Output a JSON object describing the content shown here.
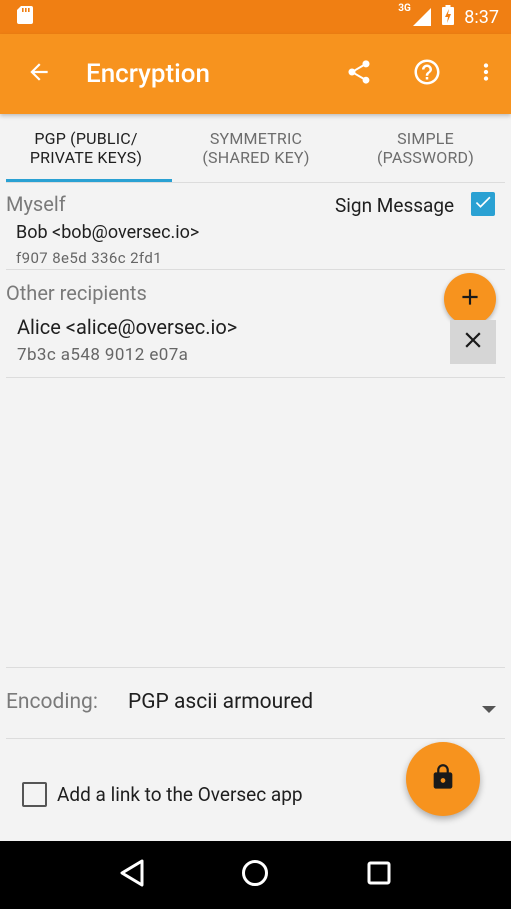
{
  "status_bar": {
    "time": "8:37",
    "network": "3G",
    "icons": [
      "sd-card-icon",
      "signal-icon",
      "battery-charging-icon"
    ]
  },
  "app_bar": {
    "title": "Encryption",
    "icons": [
      "back-arrow-icon",
      "share-icon",
      "help-icon",
      "more-vert-icon"
    ]
  },
  "tabs": [
    {
      "label": "PGP (PUBLIC/\nPRIVATE KEYS)",
      "active": true
    },
    {
      "label": "SYMMETRIC\n(SHARED KEY)",
      "active": false
    },
    {
      "label": "SIMPLE\n(PASSWORD)",
      "active": false
    }
  ],
  "myself": {
    "section_label": "Myself",
    "sign_message_label": "Sign Message",
    "sign_message_checked": true,
    "key": {
      "name": "Bob <bob@oversec.io>",
      "fingerprint": "f907 8e5d 336c 2fd1"
    }
  },
  "recipients": {
    "section_label": "Other recipients",
    "items": [
      {
        "name": "Alice <alice@oversec.io>",
        "fingerprint": "7b3c a548 9012 e07a"
      }
    ]
  },
  "encoding": {
    "label": "Encoding:",
    "value": "PGP ascii armoured"
  },
  "footer": {
    "link_label": "Add a link to the Oversec app",
    "link_checked": false
  },
  "colors": {
    "status_bar": "#f07f13",
    "app_bar": "#f7931e",
    "accent": "#2aa1d3",
    "fab": "#f7931e"
  },
  "nav_bar": {
    "icons": [
      "nav-back-icon",
      "nav-home-icon",
      "nav-recents-icon"
    ]
  }
}
